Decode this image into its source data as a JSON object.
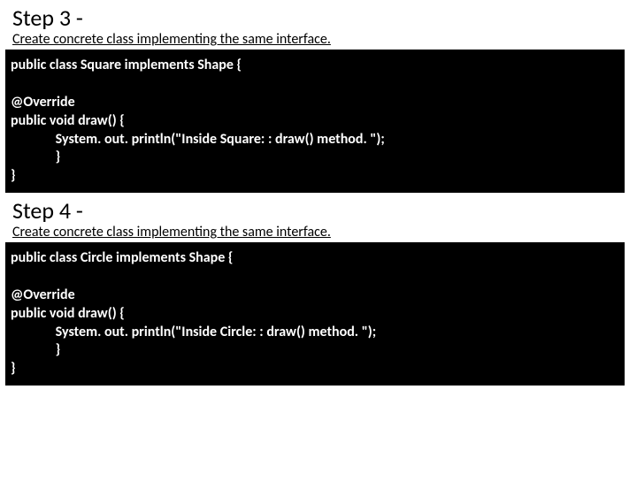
{
  "steps": [
    {
      "title": "Step 3 -",
      "desc": "Create concrete class implementing the same interface.",
      "code": "public class Square implements Shape {\n\n@Override\npublic void draw() {\n              System. out. println(\"Inside Square: : draw() method. \");\n              }\n}"
    },
    {
      "title": "Step 4 -",
      "desc": "Create concrete class  implementing the same interface.",
      "code": "public class Circle implements Shape {\n\n@Override\npublic void draw() {\n              System. out. println(\"Inside Circle: : draw() method. \");\n              }\n}"
    }
  ]
}
